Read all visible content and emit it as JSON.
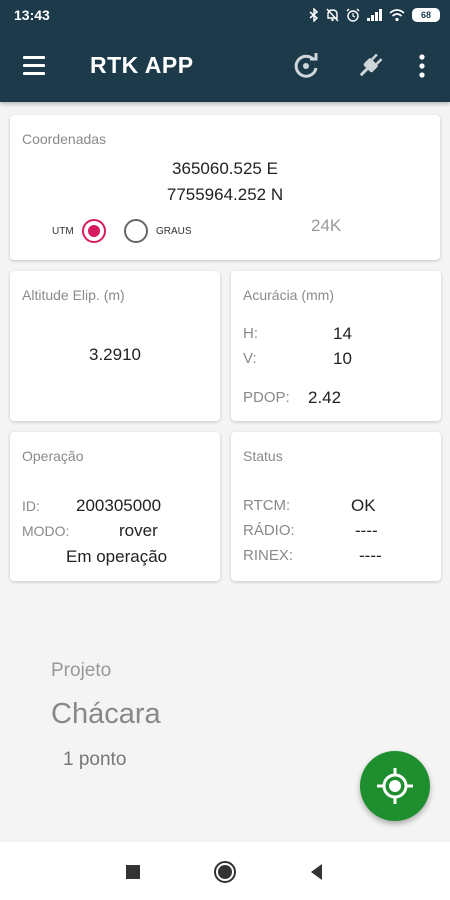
{
  "status_bar": {
    "time": "13:43",
    "battery": "68",
    "icons": [
      "bluetooth-icon",
      "notifications-off-icon",
      "alarm-icon",
      "signal-icon",
      "wifi-icon",
      "battery-icon"
    ]
  },
  "app_bar": {
    "title": "RTK APP",
    "background": "#1c3a4a",
    "actions": [
      "menu-icon",
      "refresh-icon",
      "plug-icon",
      "more-vert-icon"
    ]
  },
  "coordinates": {
    "title": "Coordenadas",
    "easting": "365060.525 E",
    "northing": "7755964.252 N",
    "options": [
      {
        "label": "UTM",
        "selected": true
      },
      {
        "label": "GRAUS",
        "selected": false
      }
    ],
    "zone": "24K",
    "accent": "#d81b60"
  },
  "altitude": {
    "title": "Altitude Elip. (m)",
    "value": "3.2910"
  },
  "accuracy": {
    "title": "Acurácia (mm)",
    "h_label": "H:",
    "h_value": "14",
    "v_label": "V:",
    "v_value": "10",
    "pdop_label": "PDOP:",
    "pdop_value": "2.42"
  },
  "operation": {
    "title": "Operação",
    "id_label": "ID:",
    "id_value": "200305000",
    "mode_label": "MODO:",
    "mode_value": "rover",
    "state": "Em operação"
  },
  "status": {
    "title": "Status",
    "rows": [
      {
        "label": "RTCM:",
        "value": "OK"
      },
      {
        "label": "RÁDIO:",
        "value": "----"
      },
      {
        "label": "RINEX:",
        "value": "----"
      }
    ]
  },
  "project": {
    "label": "Projeto",
    "name": "Chácara",
    "count": "1 ponto"
  },
  "fab": {
    "icon": "gps-target-icon",
    "color": "#1e8e2f"
  },
  "nav_bar": {
    "buttons": [
      "recents-icon",
      "home-icon",
      "back-icon"
    ]
  }
}
